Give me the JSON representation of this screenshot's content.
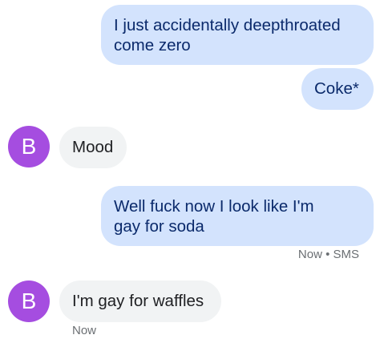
{
  "conversation": {
    "messages": [
      {
        "direction": "outgoing",
        "lines": [
          "I just accidentally deepthroated",
          "come zero"
        ]
      },
      {
        "direction": "outgoing",
        "lines": [
          "Coke*"
        ]
      },
      {
        "direction": "incoming",
        "sender_initial": "B",
        "lines": [
          "Mood"
        ]
      },
      {
        "direction": "outgoing",
        "lines": [
          "Well fuck now I look like I'm",
          "gay for soda"
        ],
        "status": "Now • SMS"
      },
      {
        "direction": "incoming",
        "sender_initial": "B",
        "lines": [
          "I'm gay for waffles"
        ],
        "status": "Now"
      }
    ]
  },
  "colors": {
    "outgoing_bubble": "#d3e3fd",
    "incoming_bubble": "#f1f3f4",
    "avatar": "#a54de0"
  }
}
